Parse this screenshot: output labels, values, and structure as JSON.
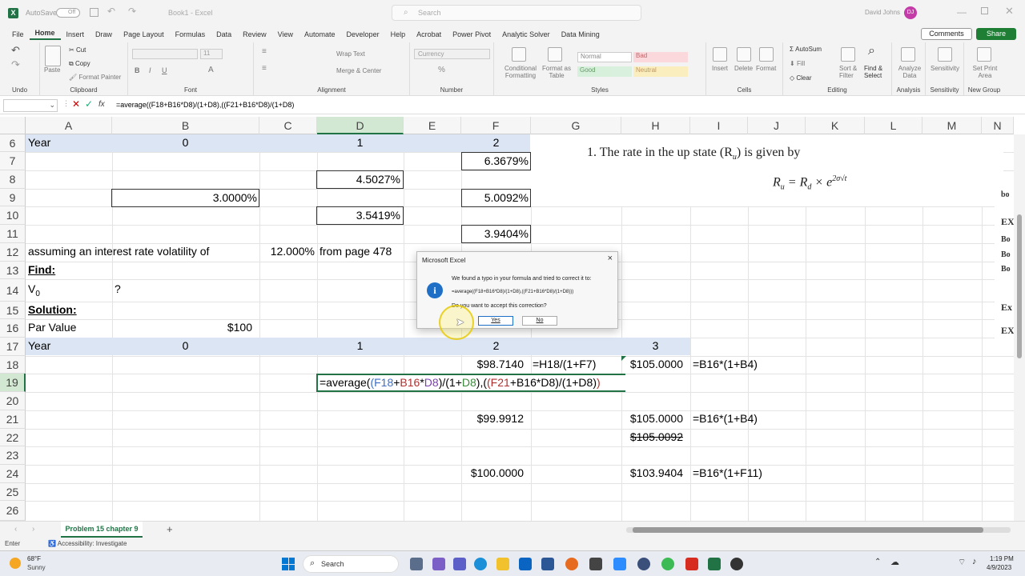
{
  "title_bar": {
    "autosave": "AutoSave",
    "autosave_state": "Off",
    "filename": "Book1 - Excel",
    "search_placeholder": "Search",
    "user": "David Johns",
    "user_initials": "DJ"
  },
  "ribbon_tabs": [
    "File",
    "Home",
    "Insert",
    "Draw",
    "Page Layout",
    "Formulas",
    "Data",
    "Review",
    "View",
    "Automate",
    "Developer",
    "Help",
    "Acrobat",
    "Power Pivot",
    "Analytic Solver",
    "Data Mining"
  ],
  "actions": {
    "comments": "Comments",
    "share": "Share"
  },
  "ribbon": {
    "undo": "Undo",
    "clipboard": {
      "label": "Clipboard",
      "paste": "Paste",
      "cut": "Cut",
      "copy": "Copy",
      "format_painter": "Format Painter"
    },
    "font": {
      "label": "Font",
      "size": "11"
    },
    "alignment": {
      "label": "Alignment",
      "wrap": "Wrap Text",
      "merge": "Merge & Center"
    },
    "number": {
      "label": "Number",
      "format": "Currency"
    },
    "styles": {
      "label": "Styles",
      "conditional": "Conditional Formatting",
      "format_table": "Format as Table",
      "normal": "Normal",
      "bad": "Bad",
      "good": "Good",
      "neutral": "Neutral"
    },
    "cells": {
      "label": "Cells",
      "insert": "Insert",
      "delete": "Delete",
      "format": "Format"
    },
    "editing": {
      "label": "Editing",
      "autosum": "AutoSum",
      "fill": "Fill",
      "clear": "Clear",
      "sort": "Sort & Filter",
      "find": "Find & Select"
    },
    "analysis": {
      "label": "Analysis",
      "analyze": "Analyze Data"
    },
    "sensitivity": {
      "label": "Sensitivity",
      "btn": "Sensitivity"
    },
    "newgroup": {
      "label": "New Group",
      "btn": "Set Print Area"
    }
  },
  "formula_bar": {
    "fx": "fx",
    "formula": "=average((F18+B16*D8)/(1+D8),((F21+B16*D8)/(1+D8)"
  },
  "columns": [
    "A",
    "B",
    "C",
    "D",
    "E",
    "F",
    "G",
    "H",
    "I",
    "J",
    "K",
    "L",
    "M",
    "N"
  ],
  "rows": [
    "6",
    "7",
    "8",
    "9",
    "10",
    "11",
    "12",
    "13",
    "14",
    "15",
    "16",
    "17",
    "18",
    "19",
    "20",
    "21",
    "22",
    "23",
    "24",
    "25",
    "26"
  ],
  "cells": {
    "a6": "Year",
    "b6": "0",
    "d6": "1",
    "f6": "2",
    "f7": "6.3679%",
    "d8": "4.5027%",
    "b9": "3.0000%",
    "f9": "5.0092%",
    "d10": "3.5419%",
    "f11": "3.9404%",
    "a12": "assuming an interest rate volatility of",
    "c12": "12.000%",
    "d12": "from page 478",
    "a13": "Find:",
    "a14": "V",
    "a14sub": "0",
    "b14": "?",
    "a15": "Solution:",
    "a16": "Par Value",
    "b16": "$100",
    "a17": "Year",
    "b17": "0",
    "d17": "1",
    "f17": "2",
    "h17": "3",
    "f18": "$98.7140",
    "g18": "=H18/(1+F7)",
    "h18": "$105.0000",
    "i18": "=B16*(1+B4)",
    "d19": "=average((F18+B16*D8)/(1+D8),((F21+B16*D8)/(1+D8))",
    "f21": "$99.9912",
    "h21": "$105.0000",
    "i21": "=B16*(1+B4)",
    "h22": "$105.0092",
    "f24": "$100.0000",
    "h24": "$103.9404",
    "i24": "=B16*(1+F11)"
  },
  "image_text": {
    "line1": "1.  The rate in the up state (R",
    "line1_sub": "u",
    "line1_end": ") is given by",
    "formula": "R",
    "formula_sub_u": "u",
    "formula_mid": " = R",
    "formula_sub_d": "d",
    "formula_end": " × e",
    "formula_sup": "2σ√t"
  },
  "side_clip": [
    "bo",
    "EX",
    "Bo",
    "Bo",
    "Bo",
    "Ex",
    "EX"
  ],
  "dialog": {
    "title": "Microsoft Excel",
    "message": "We found a typo in your formula and tried to correct it to:",
    "correction": "=average((F18+B16*D8)/(1+D8),((F21+B16*D8)/(1+D8)))",
    "question": "Do you want to accept this correction?",
    "yes": "Yes",
    "no": "No",
    "close": "×"
  },
  "sheet_tab": "Problem 15 chapter 9",
  "status": {
    "mode": "Enter",
    "accessibility": "Accessibility: Investigate"
  },
  "taskbar": {
    "temp": "68°F",
    "weather": "Sunny",
    "search": "Search",
    "time": "1:19 PM",
    "date": "4/9/2023"
  },
  "colors": {
    "accent": "#217346",
    "band": "#dce5f3",
    "share": "#1e7e34"
  }
}
